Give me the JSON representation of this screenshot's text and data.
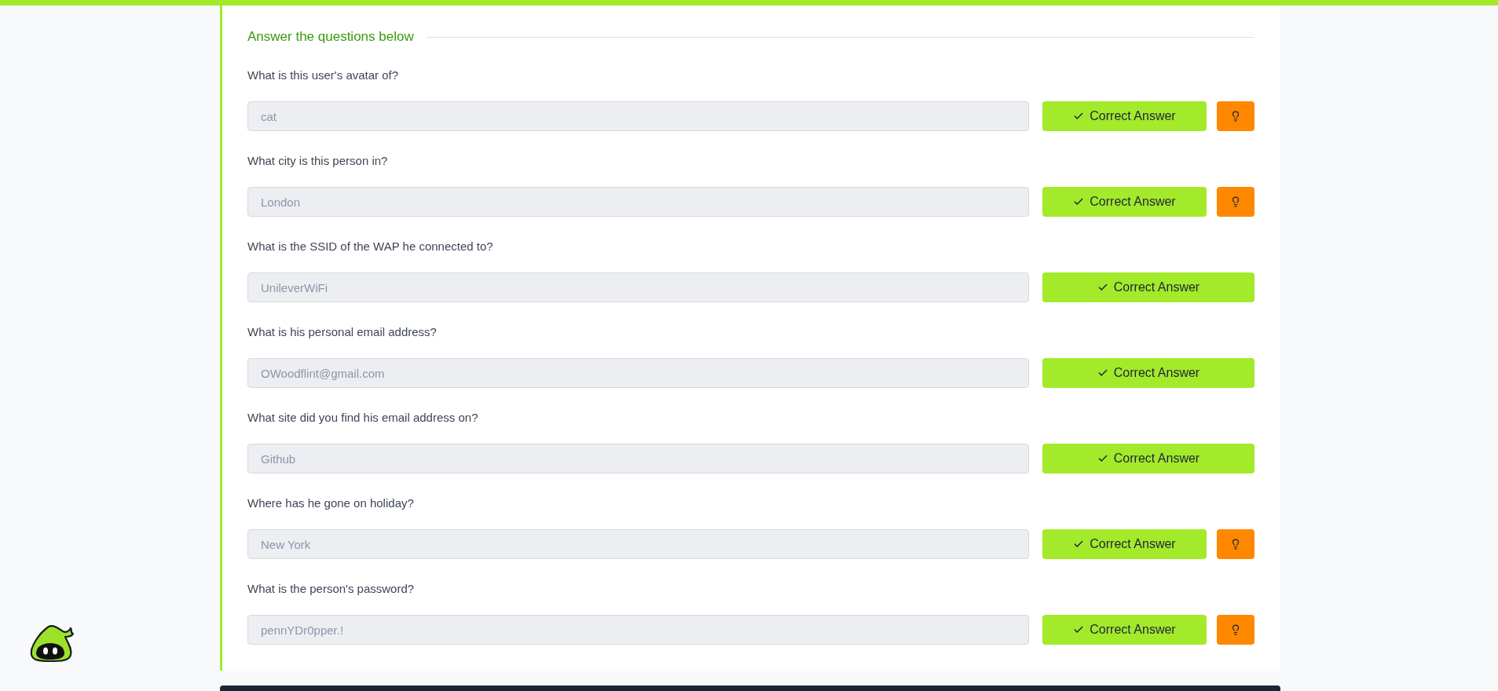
{
  "section_title": "Answer the questions below",
  "questions": [
    {
      "question": "What is this user's avatar of?",
      "answer": "cat",
      "status_label": "Correct Answer",
      "hint": true
    },
    {
      "question": "What city is this person in?",
      "answer": "London",
      "status_label": "Correct Answer",
      "hint": true
    },
    {
      "question": "What is the SSID of the WAP he connected to?",
      "answer": "UnileverWiFi",
      "status_label": "Correct Answer",
      "hint": false
    },
    {
      "question": "What is his personal email address?",
      "answer": "OWoodflint@gmail.com",
      "status_label": "Correct Answer",
      "hint": false
    },
    {
      "question": "What site did you find his email address on?",
      "answer": "Github",
      "status_label": "Correct Answer",
      "hint": false
    },
    {
      "question": "Where has he gone on holiday?",
      "answer": "New York",
      "status_label": "Correct Answer",
      "hint": true
    },
    {
      "question": "What is the person's password?",
      "answer": "pennYDr0pper.!",
      "status_label": "Correct Answer",
      "hint": true
    }
  ]
}
